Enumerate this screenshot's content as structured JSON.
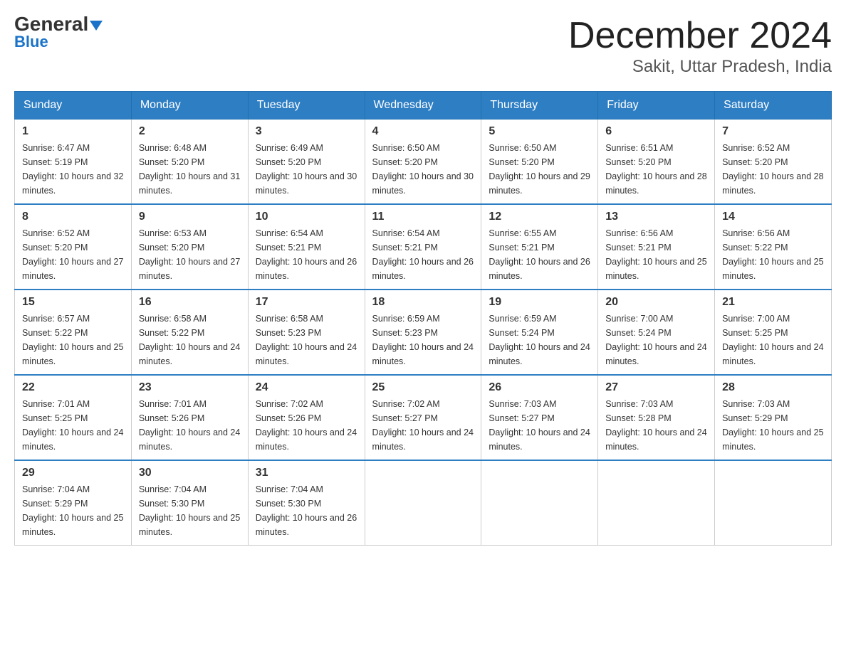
{
  "logo": {
    "name": "General",
    "name2": "Blue"
  },
  "title": "December 2024",
  "subtitle": "Sakit, Uttar Pradesh, India",
  "days_of_week": [
    "Sunday",
    "Monday",
    "Tuesday",
    "Wednesday",
    "Thursday",
    "Friday",
    "Saturday"
  ],
  "weeks": [
    [
      {
        "day": "1",
        "sunrise": "6:47 AM",
        "sunset": "5:19 PM",
        "daylight": "10 hours and 32 minutes."
      },
      {
        "day": "2",
        "sunrise": "6:48 AM",
        "sunset": "5:20 PM",
        "daylight": "10 hours and 31 minutes."
      },
      {
        "day": "3",
        "sunrise": "6:49 AM",
        "sunset": "5:20 PM",
        "daylight": "10 hours and 30 minutes."
      },
      {
        "day": "4",
        "sunrise": "6:50 AM",
        "sunset": "5:20 PM",
        "daylight": "10 hours and 30 minutes."
      },
      {
        "day": "5",
        "sunrise": "6:50 AM",
        "sunset": "5:20 PM",
        "daylight": "10 hours and 29 minutes."
      },
      {
        "day": "6",
        "sunrise": "6:51 AM",
        "sunset": "5:20 PM",
        "daylight": "10 hours and 28 minutes."
      },
      {
        "day": "7",
        "sunrise": "6:52 AM",
        "sunset": "5:20 PM",
        "daylight": "10 hours and 28 minutes."
      }
    ],
    [
      {
        "day": "8",
        "sunrise": "6:52 AM",
        "sunset": "5:20 PM",
        "daylight": "10 hours and 27 minutes."
      },
      {
        "day": "9",
        "sunrise": "6:53 AM",
        "sunset": "5:20 PM",
        "daylight": "10 hours and 27 minutes."
      },
      {
        "day": "10",
        "sunrise": "6:54 AM",
        "sunset": "5:21 PM",
        "daylight": "10 hours and 26 minutes."
      },
      {
        "day": "11",
        "sunrise": "6:54 AM",
        "sunset": "5:21 PM",
        "daylight": "10 hours and 26 minutes."
      },
      {
        "day": "12",
        "sunrise": "6:55 AM",
        "sunset": "5:21 PM",
        "daylight": "10 hours and 26 minutes."
      },
      {
        "day": "13",
        "sunrise": "6:56 AM",
        "sunset": "5:21 PM",
        "daylight": "10 hours and 25 minutes."
      },
      {
        "day": "14",
        "sunrise": "6:56 AM",
        "sunset": "5:22 PM",
        "daylight": "10 hours and 25 minutes."
      }
    ],
    [
      {
        "day": "15",
        "sunrise": "6:57 AM",
        "sunset": "5:22 PM",
        "daylight": "10 hours and 25 minutes."
      },
      {
        "day": "16",
        "sunrise": "6:58 AM",
        "sunset": "5:22 PM",
        "daylight": "10 hours and 24 minutes."
      },
      {
        "day": "17",
        "sunrise": "6:58 AM",
        "sunset": "5:23 PM",
        "daylight": "10 hours and 24 minutes."
      },
      {
        "day": "18",
        "sunrise": "6:59 AM",
        "sunset": "5:23 PM",
        "daylight": "10 hours and 24 minutes."
      },
      {
        "day": "19",
        "sunrise": "6:59 AM",
        "sunset": "5:24 PM",
        "daylight": "10 hours and 24 minutes."
      },
      {
        "day": "20",
        "sunrise": "7:00 AM",
        "sunset": "5:24 PM",
        "daylight": "10 hours and 24 minutes."
      },
      {
        "day": "21",
        "sunrise": "7:00 AM",
        "sunset": "5:25 PM",
        "daylight": "10 hours and 24 minutes."
      }
    ],
    [
      {
        "day": "22",
        "sunrise": "7:01 AM",
        "sunset": "5:25 PM",
        "daylight": "10 hours and 24 minutes."
      },
      {
        "day": "23",
        "sunrise": "7:01 AM",
        "sunset": "5:26 PM",
        "daylight": "10 hours and 24 minutes."
      },
      {
        "day": "24",
        "sunrise": "7:02 AM",
        "sunset": "5:26 PM",
        "daylight": "10 hours and 24 minutes."
      },
      {
        "day": "25",
        "sunrise": "7:02 AM",
        "sunset": "5:27 PM",
        "daylight": "10 hours and 24 minutes."
      },
      {
        "day": "26",
        "sunrise": "7:03 AM",
        "sunset": "5:27 PM",
        "daylight": "10 hours and 24 minutes."
      },
      {
        "day": "27",
        "sunrise": "7:03 AM",
        "sunset": "5:28 PM",
        "daylight": "10 hours and 24 minutes."
      },
      {
        "day": "28",
        "sunrise": "7:03 AM",
        "sunset": "5:29 PM",
        "daylight": "10 hours and 25 minutes."
      }
    ],
    [
      {
        "day": "29",
        "sunrise": "7:04 AM",
        "sunset": "5:29 PM",
        "daylight": "10 hours and 25 minutes."
      },
      {
        "day": "30",
        "sunrise": "7:04 AM",
        "sunset": "5:30 PM",
        "daylight": "10 hours and 25 minutes."
      },
      {
        "day": "31",
        "sunrise": "7:04 AM",
        "sunset": "5:30 PM",
        "daylight": "10 hours and 26 minutes."
      },
      null,
      null,
      null,
      null
    ]
  ],
  "labels": {
    "sunrise": "Sunrise:",
    "sunset": "Sunset:",
    "daylight": "Daylight:"
  }
}
